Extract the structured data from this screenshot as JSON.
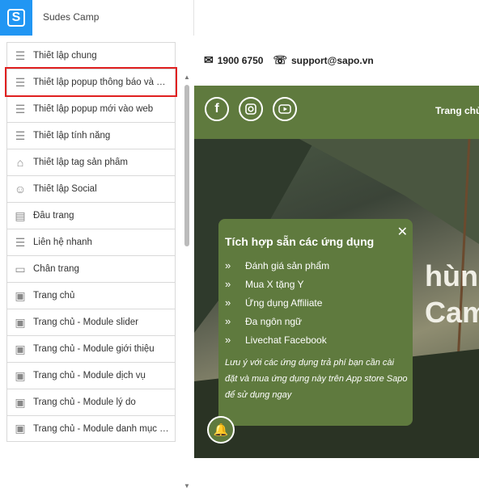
{
  "app": {
    "title": "Sudes Camp",
    "logo_letter": "S",
    "logo_color": "#2196f3"
  },
  "sidebar": {
    "items": [
      {
        "label": "Thiết lập chung",
        "icon": "settings-sliders-icon"
      },
      {
        "label": "Thiết lập popup thông báo và …",
        "icon": "settings-sliders-icon",
        "selected": true
      },
      {
        "label": "Thiết lập popup mới vào web",
        "icon": "settings-sliders-icon"
      },
      {
        "label": "Thiết lập tính năng",
        "icon": "settings-sliders-icon"
      },
      {
        "label": "Thiết lập tag sản phẩm",
        "icon": "tag-icon"
      },
      {
        "label": "Thiết lập Social",
        "icon": "social-icon"
      },
      {
        "label": "Đầu trang",
        "icon": "header-layout-icon"
      },
      {
        "label": "Liên hệ nhanh",
        "icon": "settings-sliders-icon"
      },
      {
        "label": "Chân trang",
        "icon": "footer-layout-icon"
      },
      {
        "label": "Trang chủ",
        "icon": "page-icon"
      },
      {
        "label": "Trang chủ - Module slider",
        "icon": "page-icon"
      },
      {
        "label": "Trang chủ - Module giới thiệu",
        "icon": "page-icon"
      },
      {
        "label": "Trang chủ - Module dịch vụ",
        "icon": "page-icon"
      },
      {
        "label": "Trang chủ - Module lý do",
        "icon": "page-icon"
      },
      {
        "label": "Trang chủ - Module danh mục …",
        "icon": "page-icon"
      }
    ]
  },
  "preview": {
    "phone": "1900 6750",
    "email": "support@sapo.vn",
    "nav_home": "Trang chủ",
    "hero_text": [
      "hùng c",
      "Camp"
    ],
    "accent": "#5f7a3e",
    "popup": {
      "title": "Tích hợp sẵn các ứng dụng",
      "items": [
        "Đánh giá sản phẩm",
        "Mua X tặng Y",
        "Ứng dụng Affiliate",
        "Đa ngôn ngữ",
        "Livechat Facebook"
      ],
      "note": "Lưu ý với các ứng dụng trả phí bạn cần cài đặt và mua ứng dụng này trên App store Sapo để sử dụng ngay"
    }
  }
}
